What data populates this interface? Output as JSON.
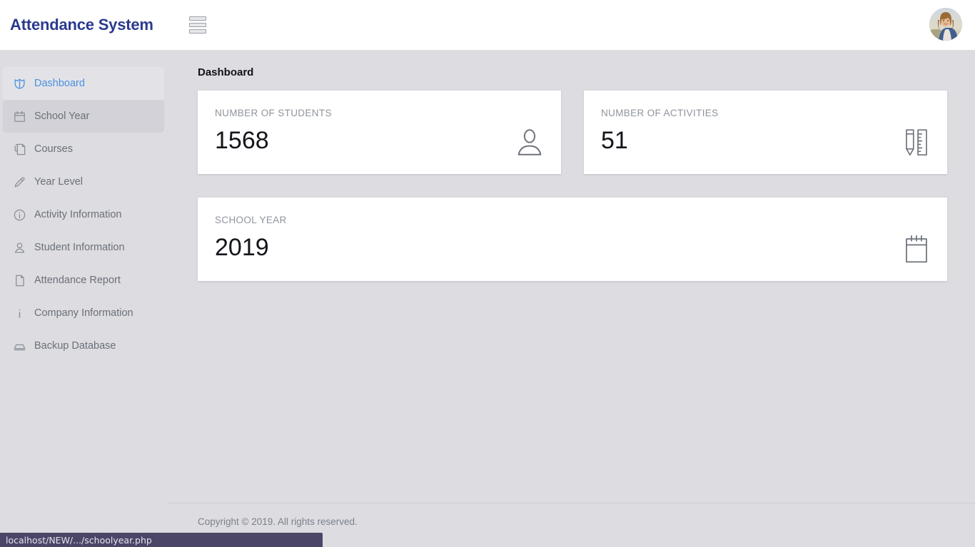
{
  "header": {
    "brand": "Attendance System",
    "menu_icon": "hamburger-icon",
    "avatar_alt": "user-avatar"
  },
  "sidebar": {
    "items": [
      {
        "label": "Dashboard",
        "icon": "shield-icon",
        "state": "active"
      },
      {
        "label": "School Year",
        "icon": "calendar-icon",
        "state": "hovered"
      },
      {
        "label": "Courses",
        "icon": "document-clip-icon",
        "state": "normal"
      },
      {
        "label": "Year Level",
        "icon": "pencil-icon",
        "state": "normal"
      },
      {
        "label": "Activity Information",
        "icon": "info-circle-icon",
        "state": "normal"
      },
      {
        "label": "Student Information",
        "icon": "user-icon",
        "state": "normal"
      },
      {
        "label": "Attendance Report",
        "icon": "file-icon",
        "state": "normal"
      },
      {
        "label": "Company Information",
        "icon": "info-line-icon",
        "state": "normal"
      },
      {
        "label": "Backup Database",
        "icon": "drawer-icon",
        "state": "normal"
      }
    ]
  },
  "main": {
    "page_title": "Dashboard",
    "cards": [
      {
        "label": "NUMBER OF STUDENTS",
        "value": "1568",
        "icon": "person-icon"
      },
      {
        "label": "NUMBER OF ACTIVITIES",
        "value": "51",
        "icon": "pencil-ruler-icon"
      },
      {
        "label": "SCHOOL YEAR",
        "value": "2019",
        "icon": "calendar-page-icon"
      }
    ]
  },
  "footer": {
    "copyright": "Copyright © 2019. All rights reserved."
  },
  "status_bar": {
    "url": "localhost/NEW/.../schoolyear.php"
  },
  "colors": {
    "brand": "#2b3a8f",
    "accent": "#4a90e2",
    "page_bg": "#dcdce1",
    "card_bg": "#ffffff",
    "muted_text": "#8f949c",
    "status_bar_bg": "#4b4567"
  }
}
